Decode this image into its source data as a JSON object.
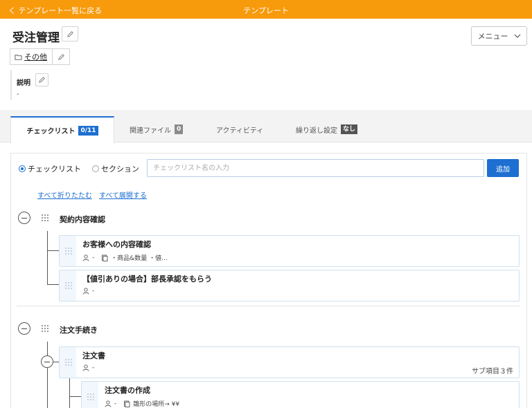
{
  "header": {
    "back_label": "く テンプレート一覧に戻る",
    "center_title": "テンプレート",
    "color": "#f79a0c"
  },
  "page": {
    "title": "受注管理",
    "menu_label": "メニュー",
    "category": "その他",
    "description_label": "説明",
    "description_value": "-"
  },
  "tabs": [
    {
      "label": "チェックリスト",
      "badge": "0/11",
      "active": true
    },
    {
      "label": "関連ファイル",
      "badge": "0"
    },
    {
      "label": "アクティビティ"
    },
    {
      "label": "繰り返し設定",
      "badge": "なし"
    }
  ],
  "add_form": {
    "radio_checklist": "チェックリスト",
    "radio_section": "セクション",
    "placeholder": "チェックリスト名の入力",
    "add_button": "追加"
  },
  "links": {
    "collapse_all": "すべて折りたたむ",
    "expand_all": "すべて展開する"
  },
  "sections": [
    {
      "title": "契約内容確認",
      "items": [
        {
          "title": "お客様への内容確認",
          "assignee": "-",
          "note": "・商品&数量 ・値…"
        },
        {
          "title": "【値引ありの場合】部長承認をもらう",
          "assignee": "-"
        }
      ]
    },
    {
      "title": "注文手続き",
      "items": [
        {
          "title": "注文書",
          "assignee": "-",
          "subcount": "サブ項目３件",
          "children": [
            {
              "title": "注文書の作成",
              "assignee": "-",
              "note": "雛形の場所→ ¥¥"
            }
          ]
        }
      ]
    }
  ],
  "colors": {
    "accent": "#1d6fd1"
  }
}
